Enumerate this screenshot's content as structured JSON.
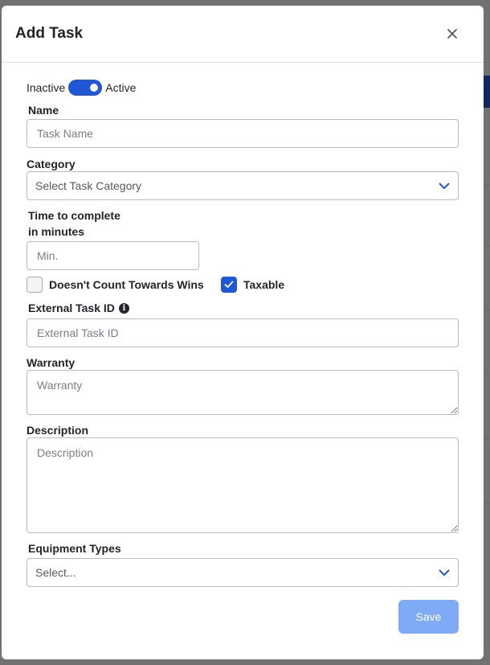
{
  "modal": {
    "title": "Add Task",
    "close_icon": "close-icon"
  },
  "status_toggle": {
    "inactive_label": "Inactive",
    "active_label": "Active",
    "value": "Active"
  },
  "name": {
    "label": "Name",
    "placeholder": "Task Name",
    "value": ""
  },
  "category": {
    "label": "Category",
    "selected": "Select Task Category",
    "icon": "chevron-down-icon"
  },
  "time": {
    "label_line1": "Time to complete",
    "label_line2": "in minutes",
    "placeholder": "Min.",
    "value": ""
  },
  "checkboxes": {
    "wins_label": "Doesn't Count Towards Wins",
    "wins_checked": false,
    "taxable_label": "Taxable",
    "taxable_checked": true
  },
  "external_id": {
    "label": "External Task ID",
    "placeholder": "External Task ID",
    "info_icon": "info-icon",
    "value": ""
  },
  "warranty": {
    "label": "Warranty",
    "placeholder": "Warranty",
    "value": ""
  },
  "description": {
    "label": "Description",
    "placeholder": "Description",
    "value": ""
  },
  "equipment": {
    "label": "Equipment Types",
    "selected": "Select...",
    "icon": "chevron-down-icon"
  },
  "footer": {
    "save_label": "Save"
  },
  "colors": {
    "primary": "#1f58d6",
    "save_disabled": "#7eaaf6",
    "overlay": "#6f6f6f"
  }
}
